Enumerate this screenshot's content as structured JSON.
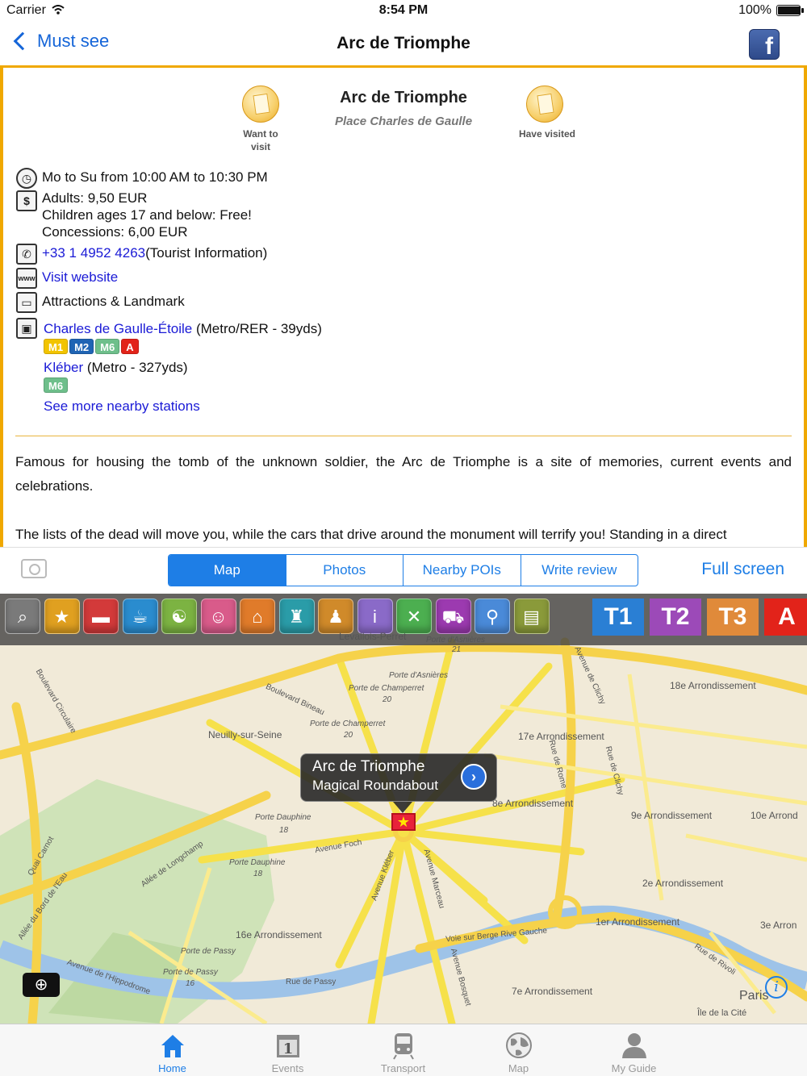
{
  "status": {
    "carrier": "Carrier",
    "time": "8:54 PM",
    "battery": "100%",
    "battery_level": 1.0
  },
  "nav": {
    "back_label": "Must see",
    "title": "Arc de Triomphe",
    "share_icon": "facebook-icon"
  },
  "poi": {
    "title": "Arc de Triomphe",
    "subtitle": "Place Charles de Gaulle",
    "want_to_visit": "Want to\nvisit",
    "have_visited": "Have visited",
    "hours": "Mo to Su from 10:00 AM to 10:30 PM",
    "prices": {
      "adults": "Adults: 9,50 EUR",
      "children": "Children ages 17 and below: Free!",
      "concessions": "Concessions: 6,00 EUR"
    },
    "phone": "+33 1 4952 4263",
    "phone_note": "(Tourist Information)",
    "website": "Visit website",
    "category": "Attractions & Landmark",
    "stations": [
      {
        "name": "Charles de Gaulle-Étoile",
        "info": " (Metro/RER - 39yds)",
        "lines": [
          "M1",
          "M2",
          "M6",
          "A"
        ]
      },
      {
        "name": "Kléber",
        "info": " (Metro - 327yds)",
        "lines": [
          "M6"
        ]
      }
    ],
    "more_stations": "See more nearby stations",
    "description_1": "Famous for housing the tomb of the unknown soldier, the Arc de Triomphe is a site of memories, current events and celebrations.",
    "description_2": "The lists of the dead will move you, while the cars that drive around the monument will terrify you! Standing in a direct"
  },
  "line_colors": {
    "M1": "#f2c400",
    "M2": "#1f64b4",
    "M6": "#6ebf8b",
    "A": "#e2231a"
  },
  "segments": {
    "tabs": [
      "Map",
      "Photos",
      "Nearby POIs",
      "Write review"
    ],
    "active": "Map",
    "full_screen": "Full screen"
  },
  "map": {
    "category_icons": [
      "search-icon",
      "star-icon",
      "hotel-icon",
      "cafe-icon",
      "yin-yang-icon",
      "theater-icon",
      "museum-icon",
      "nightlife-icon",
      "hiking-icon",
      "info-icon",
      "restaurant-icon",
      "shopping-icon",
      "pin-icon",
      "train-icon"
    ],
    "lines": [
      "T1",
      "T2",
      "T3",
      "A"
    ],
    "callout_title": "Arc de Triomphe",
    "callout_subtitle": "Magical Roundabout",
    "labels": [
      "Levallois-Perret",
      "Porte d'Asnières",
      "21",
      "Porte d'Asnières",
      "Porte de Champerret",
      "20",
      "Boulevard Bineau",
      "Boulevard Circulaire",
      "Porte de Champerret",
      "20",
      "Neuilly-sur-Seine",
      "18e Arrondissement",
      "17e Arrondissement",
      "Avenue de Clichy",
      "Rue de Rome",
      "Rue de Clichy",
      "8e Arrondissement",
      "9e Arrondissement",
      "10e Arrond",
      "Porte Dauphine",
      "18",
      "Avenue Foch",
      "Porte Dauphine",
      "18",
      "Quai Carnot",
      "Allée du Bord de l'Eau",
      "Allée de Longchamp",
      "Avenue Kléber",
      "Avenue Marceau",
      "2e Arrondissement",
      "1er Arrondissement",
      "3e Arron",
      "16e Arrondissement",
      "Voie sur Berge Rive Gauche",
      "Avenue Bosquet",
      "Porte de Passy",
      "Avenue de l'Hippodrome",
      "Porte de Passy",
      "16",
      "Rue de Passy",
      "7e Arrondissement",
      "Rue de Rivoli",
      "Paris",
      "Île de la Cité"
    ]
  },
  "tabs": [
    {
      "label": "Home",
      "icon": "home-icon",
      "active": true
    },
    {
      "label": "Events",
      "icon": "calendar-icon",
      "active": false
    },
    {
      "label": "Transport",
      "icon": "train-icon",
      "active": false
    },
    {
      "label": "Map",
      "icon": "globe-icon",
      "active": false
    },
    {
      "label": "My Guide",
      "icon": "person-icon",
      "active": false
    }
  ]
}
